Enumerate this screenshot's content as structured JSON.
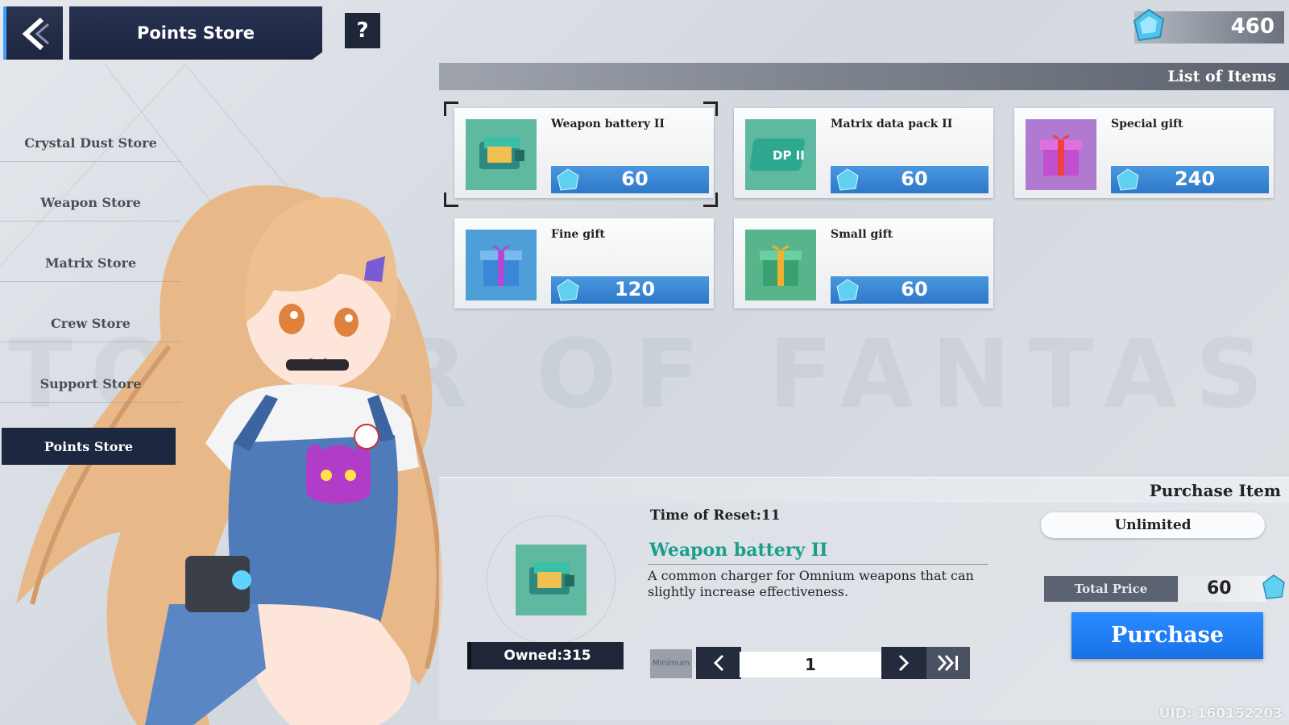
{
  "header": {
    "title": "Points Store",
    "help_label": "?",
    "currency_value": "460"
  },
  "sidebar": {
    "items": [
      {
        "label": "Crystal Dust Store"
      },
      {
        "label": "Weapon Store"
      },
      {
        "label": "Matrix Store"
      },
      {
        "label": "Crew Store"
      },
      {
        "label": "Support Store"
      },
      {
        "label": "Points Store",
        "active": true
      }
    ]
  },
  "watermark": "TOWER OF FANTASY",
  "list": {
    "title": "List of Items",
    "items": [
      {
        "name": "Weapon battery II",
        "price": "60",
        "icon": "weapon-battery-icon",
        "selected": true
      },
      {
        "name": "Matrix data pack II",
        "price": "60",
        "icon": "matrix-data-pack-icon"
      },
      {
        "name": "Special gift",
        "price": "240",
        "icon": "special-gift-icon"
      },
      {
        "name": "Fine gift",
        "price": "120",
        "icon": "fine-gift-icon"
      },
      {
        "name": "Small gift",
        "price": "60",
        "icon": "small-gift-icon"
      }
    ]
  },
  "purchase": {
    "title": "Purchase Item",
    "reset_time": "Time of Reset:11",
    "item_name": "Weapon battery II",
    "description": "A common charger for Omnium weapons that can slightly increase effectiveness.",
    "owned": "Owned:315",
    "min_label": "Minimum",
    "quantity": "1",
    "limit": "Unlimited",
    "total_label": "Total Price",
    "total_value": "60",
    "button_label": "Purchase"
  },
  "uid": "UID: 160152203",
  "colors": {
    "accent_blue": "#2a8cff",
    "dark_panel": "#1e2638",
    "item_title": "#1e9e8a"
  }
}
